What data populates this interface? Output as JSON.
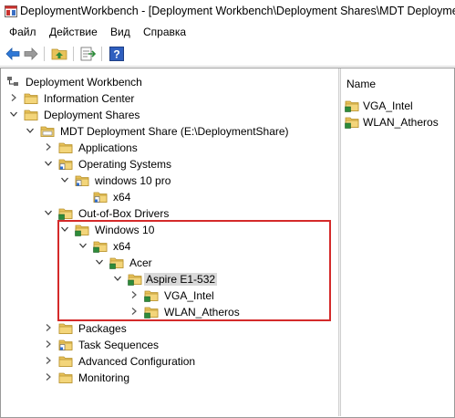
{
  "window": {
    "title": "DeploymentWorkbench - [Deployment Workbench\\Deployment Shares\\MDT Deployment"
  },
  "menu": {
    "items": [
      "Файл",
      "Действие",
      "Вид",
      "Справка"
    ]
  },
  "toolbar": {
    "buttons": [
      "back-arrow-icon",
      "forward-arrow-icon",
      "up-folder-icon",
      "export-list-icon",
      "help-icon"
    ]
  },
  "tree": {
    "root": "Deployment Workbench",
    "information_center": "Information Center",
    "deployment_shares": "Deployment Shares",
    "mdt_share": "MDT Deployment Share (E:\\DeploymentShare)",
    "applications": "Applications",
    "operating_systems": "Operating Systems",
    "windows_10_pro": "windows 10 pro",
    "x64_os": "x64",
    "out_of_box_drivers": "Out-of-Box Drivers",
    "windows_10": "Windows 10",
    "x64_drivers": "x64",
    "acer": "Acer",
    "aspire": "Aspire E1-532",
    "vga_intel": "VGA_Intel",
    "wlan_atheros": "WLAN_Atheros",
    "packages": "Packages",
    "task_sequences": "Task Sequences",
    "advanced_configuration": "Advanced Configuration",
    "monitoring": "Monitoring"
  },
  "list": {
    "column_name": "Name",
    "items": [
      "VGA_Intel",
      "WLAN_Atheros"
    ]
  },
  "colors": {
    "highlight_box": "#d42a2a",
    "selection": "#d9d9d9",
    "folder": "#e8c25a"
  }
}
